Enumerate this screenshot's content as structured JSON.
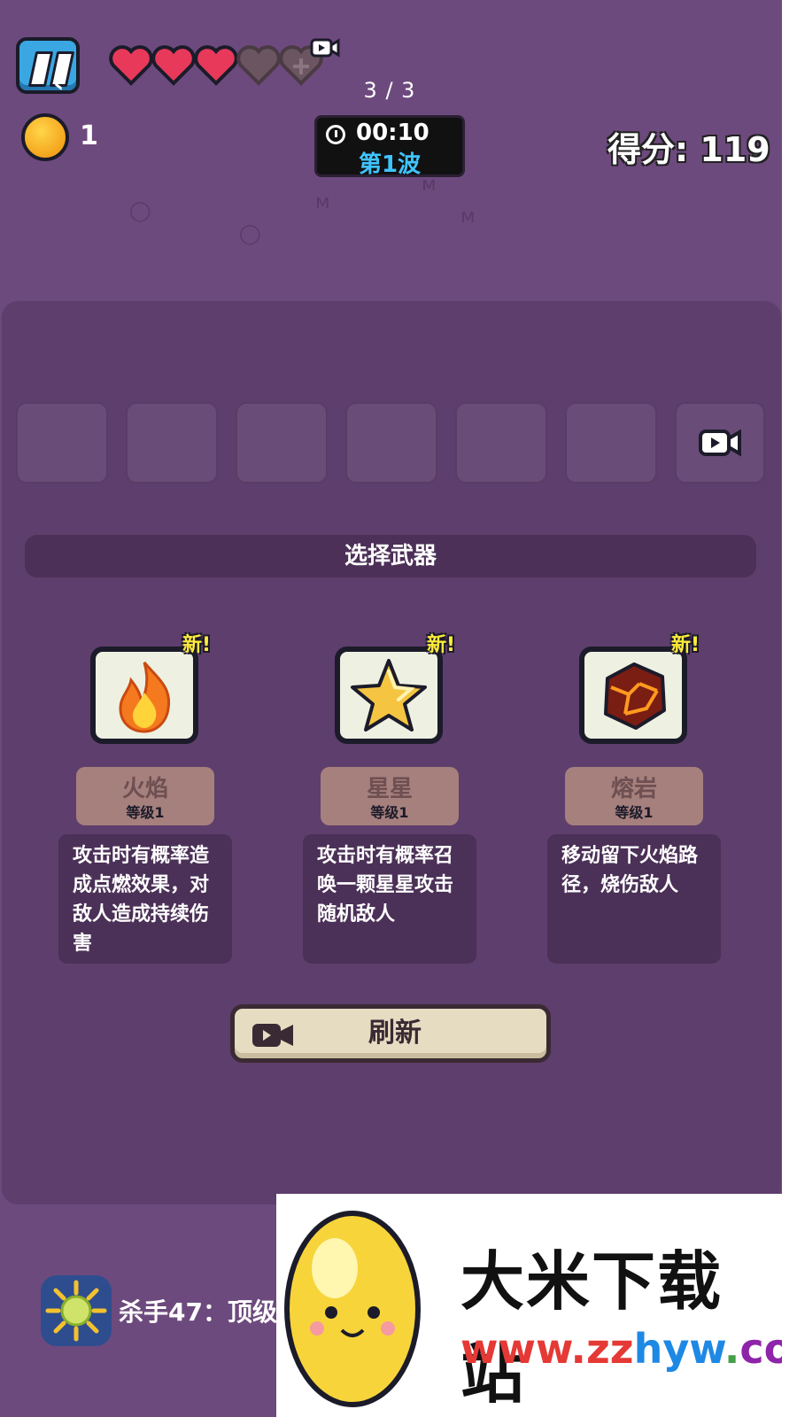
{
  "hud": {
    "page_counter": "3 / 3",
    "coins": "1",
    "timer": "00:10",
    "wave": "第1波",
    "score": "得分: 119",
    "hearts": {
      "full": 3,
      "empty": 2
    }
  },
  "panel": {
    "title": "选择武器",
    "slots_empty": 6,
    "choices": [
      {
        "badge": "新!",
        "name": "火焰",
        "level": "等级1",
        "description": "攻击时有概率造成点燃效果，对敌人造成持续伤害",
        "icon": "fire-icon"
      },
      {
        "badge": "新!",
        "name": "星星",
        "level": "等级1",
        "description": "攻击时有概率召唤一颗星星攻击随机敌人",
        "icon": "star-icon"
      },
      {
        "badge": "新!",
        "name": "熔岩",
        "level": "等级1",
        "description": "移动留下火焰路径，烧伤敌人",
        "icon": "lava-rock-icon"
      }
    ],
    "refresh_label": "刷新"
  },
  "bottom": {
    "app_name": "杀手47：顶级"
  },
  "watermark": {
    "title": "大米下载站",
    "url": "www.zzhyw.com"
  },
  "colors": {
    "background": "#6d4a7d",
    "panel": "#5e3e6c",
    "wave_text": "#40c4ff",
    "new_badge": "#ffeb3b",
    "heart_full": "#e8395a",
    "heart_empty": "#6a5560"
  }
}
